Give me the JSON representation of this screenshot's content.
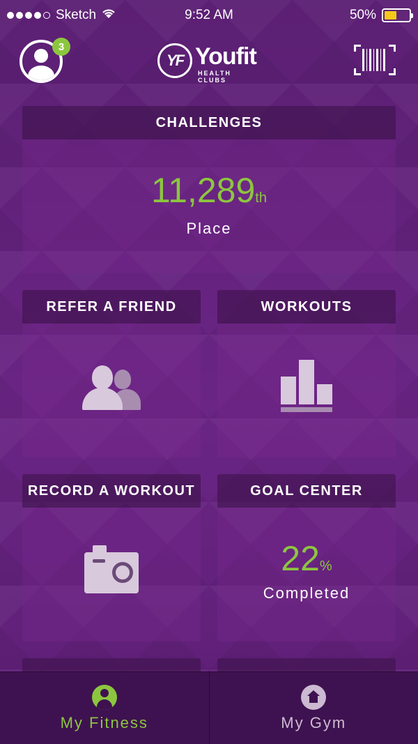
{
  "status_bar": {
    "carrier": "Sketch",
    "time": "9:52 AM",
    "battery": "50%",
    "battery_level": 0.5
  },
  "header": {
    "notification_count": "3",
    "logo_name": "Youfit",
    "logo_sub": "HEALTH CLUBS",
    "logo_mark": "YF"
  },
  "cards": {
    "challenges": {
      "title": "CHALLENGES",
      "value": "11,289",
      "suffix": "th",
      "label": "Place"
    },
    "refer": {
      "title": "REFER A FRIEND",
      "icon": "people-icon"
    },
    "workouts": {
      "title": "WORKOUTS",
      "icon": "bar-chart-icon"
    },
    "record": {
      "title": "RECORD A WORKOUT",
      "icon": "camera-icon"
    },
    "goal": {
      "title": "GOAL CENTER",
      "value": "22",
      "suffix": "%",
      "label": "Completed"
    }
  },
  "tabs": [
    {
      "label": "My Fitness",
      "icon": "person-icon",
      "active": true
    },
    {
      "label": "My Gym",
      "icon": "home-icon",
      "active": false
    }
  ],
  "colors": {
    "accent": "#8cc63f",
    "background": "#5a1e72",
    "tab_bar": "#3e1250"
  }
}
